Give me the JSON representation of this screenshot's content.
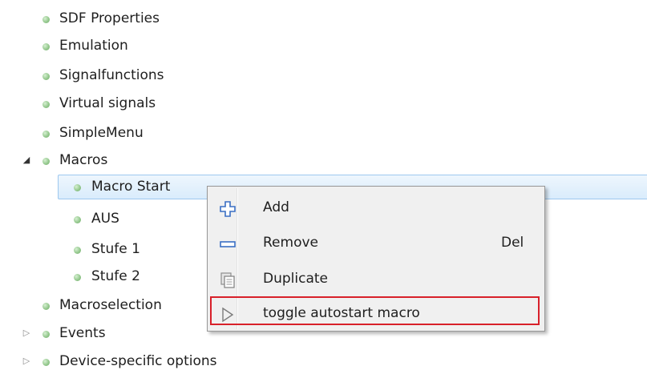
{
  "tree": {
    "items": [
      {
        "label": "SDF Properties"
      },
      {
        "label": "Emulation"
      },
      {
        "label": "Signalfunctions"
      },
      {
        "label": "Virtual signals"
      },
      {
        "label": "SimpleMenu"
      },
      {
        "label": "Macros",
        "state": "expanded"
      },
      {
        "label": "Macro Start",
        "state": "selected"
      },
      {
        "label": "AUS"
      },
      {
        "label": "Stufe 1"
      },
      {
        "label": "Stufe 2"
      },
      {
        "label": "Macroselection"
      },
      {
        "label": "Events",
        "state": "collapsed"
      },
      {
        "label": "Device-specific options",
        "state": "collapsed"
      }
    ]
  },
  "context_menu": {
    "items": [
      {
        "label": "Add",
        "icon": "plus-icon"
      },
      {
        "label": "Remove",
        "icon": "minus-icon",
        "shortcut": "Del"
      },
      {
        "label": "Duplicate",
        "icon": "duplicate-icon"
      },
      {
        "label": "toggle autostart macro",
        "icon": "play-outline-icon",
        "highlighted": true
      }
    ]
  },
  "colors": {
    "node_dot": "#96c98f",
    "selection_bg": "#d9ecfc",
    "selection_border": "#9ec8ef",
    "highlight_border": "#d8202a",
    "plus_icon": "#3a6fc4",
    "minus_icon": "#3a6fc4"
  }
}
